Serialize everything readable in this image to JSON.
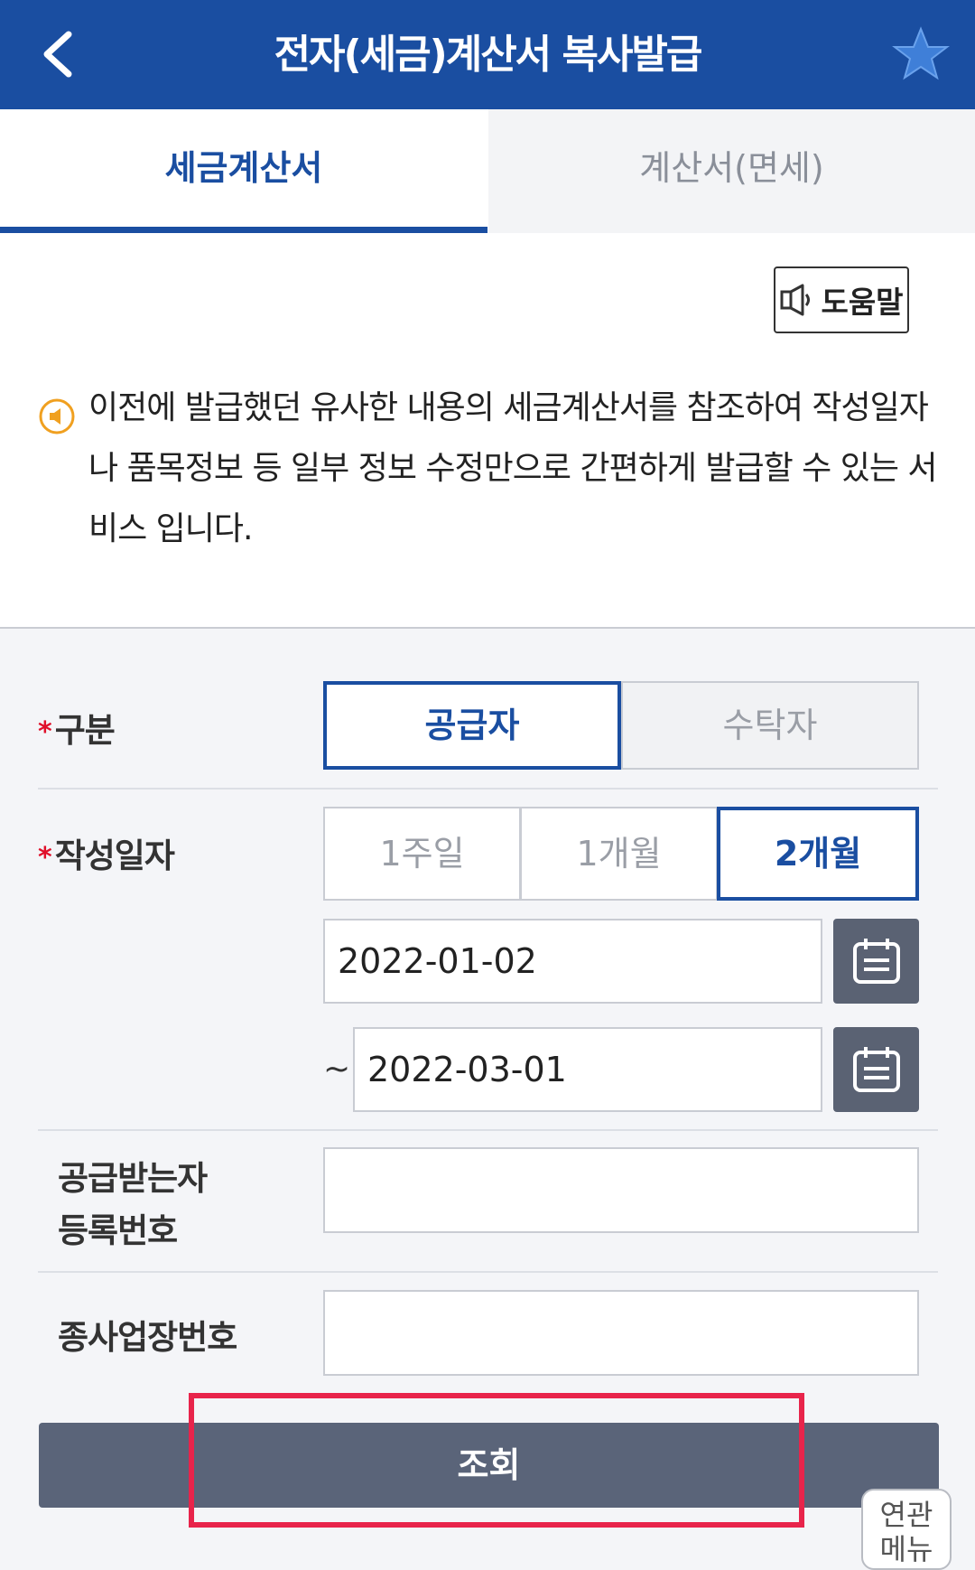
{
  "header": {
    "title": "전자(세금)계산서 복사발급"
  },
  "tabs": [
    {
      "label": "세금계산서",
      "active": true
    },
    {
      "label": "계산서(면세)",
      "active": false
    }
  ],
  "help_button": {
    "label": "도움말"
  },
  "notice": {
    "text": "이전에 발급했던 유사한 내용의 세금계산서를 참조하여 작성일자나 품목정보 등 일부 정보 수정만으로 간편하게 발급할 수 있는 서비스 입니다."
  },
  "form": {
    "required_mark": "*",
    "type": {
      "label": "구분",
      "options": [
        "공급자",
        "수탁자"
      ],
      "selected": "공급자"
    },
    "date": {
      "label": "작성일자",
      "periods": [
        "1주일",
        "1개월",
        "2개월"
      ],
      "selected": "2개월",
      "start": "2022-01-02",
      "tilde": "~",
      "end": "2022-03-01"
    },
    "receiver_reg": {
      "label_line1": "공급받는자",
      "label_line2": "등록번호",
      "value": ""
    },
    "branch_no": {
      "label": "종사업장번호",
      "value": ""
    }
  },
  "search_button": {
    "label": "조회"
  },
  "related_menu": {
    "line1": "연관",
    "line2": "메뉴"
  },
  "colors": {
    "primary": "#1a4ea1",
    "button_gray": "#5a6479",
    "highlight_red": "#e8244b",
    "required_red": "#e0102a"
  }
}
